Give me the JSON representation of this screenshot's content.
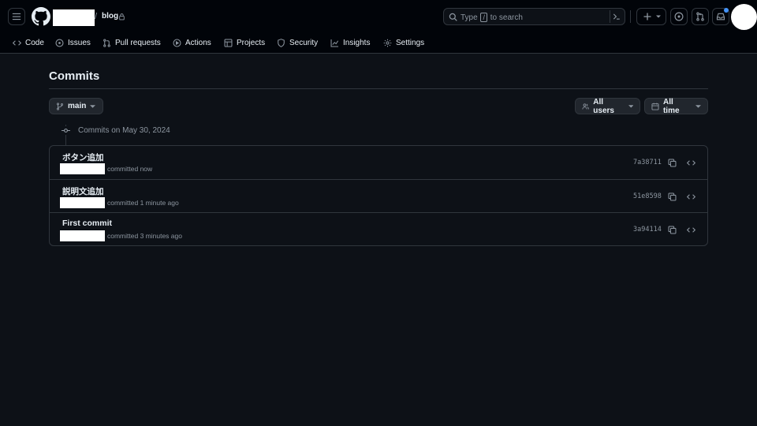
{
  "repo": {
    "name": "blog"
  },
  "search": {
    "prefix": "Type",
    "key": "/",
    "suffix": "to search"
  },
  "nav_tabs": [
    {
      "label": "Code",
      "icon": "code-icon"
    },
    {
      "label": "Issues",
      "icon": "issue-opened-icon"
    },
    {
      "label": "Pull requests",
      "icon": "git-pull-request-icon"
    },
    {
      "label": "Actions",
      "icon": "play-icon"
    },
    {
      "label": "Projects",
      "icon": "table-icon"
    },
    {
      "label": "Security",
      "icon": "shield-icon"
    },
    {
      "label": "Insights",
      "icon": "graph-icon"
    },
    {
      "label": "Settings",
      "icon": "gear-icon"
    }
  ],
  "page": {
    "title": "Commits"
  },
  "filters": {
    "branch": "main",
    "users": "All users",
    "time": "All time"
  },
  "commit_group": {
    "date_heading": "Commits on May 30, 2024",
    "commits": [
      {
        "message": "ボタン追加",
        "meta": "committed now",
        "sha": "7a38711"
      },
      {
        "message": "説明文追加",
        "meta": "committed 1 minute ago",
        "sha": "51e8598"
      },
      {
        "message": "First commit",
        "meta": "committed 3 minutes ago",
        "sha": "3a94114"
      }
    ]
  },
  "colors": {
    "background": "#0d1117",
    "header": "#010409",
    "border": "#30363d",
    "text": "#e6edf3",
    "muted": "#8d96a0",
    "notification_dot": "#4493f8"
  }
}
